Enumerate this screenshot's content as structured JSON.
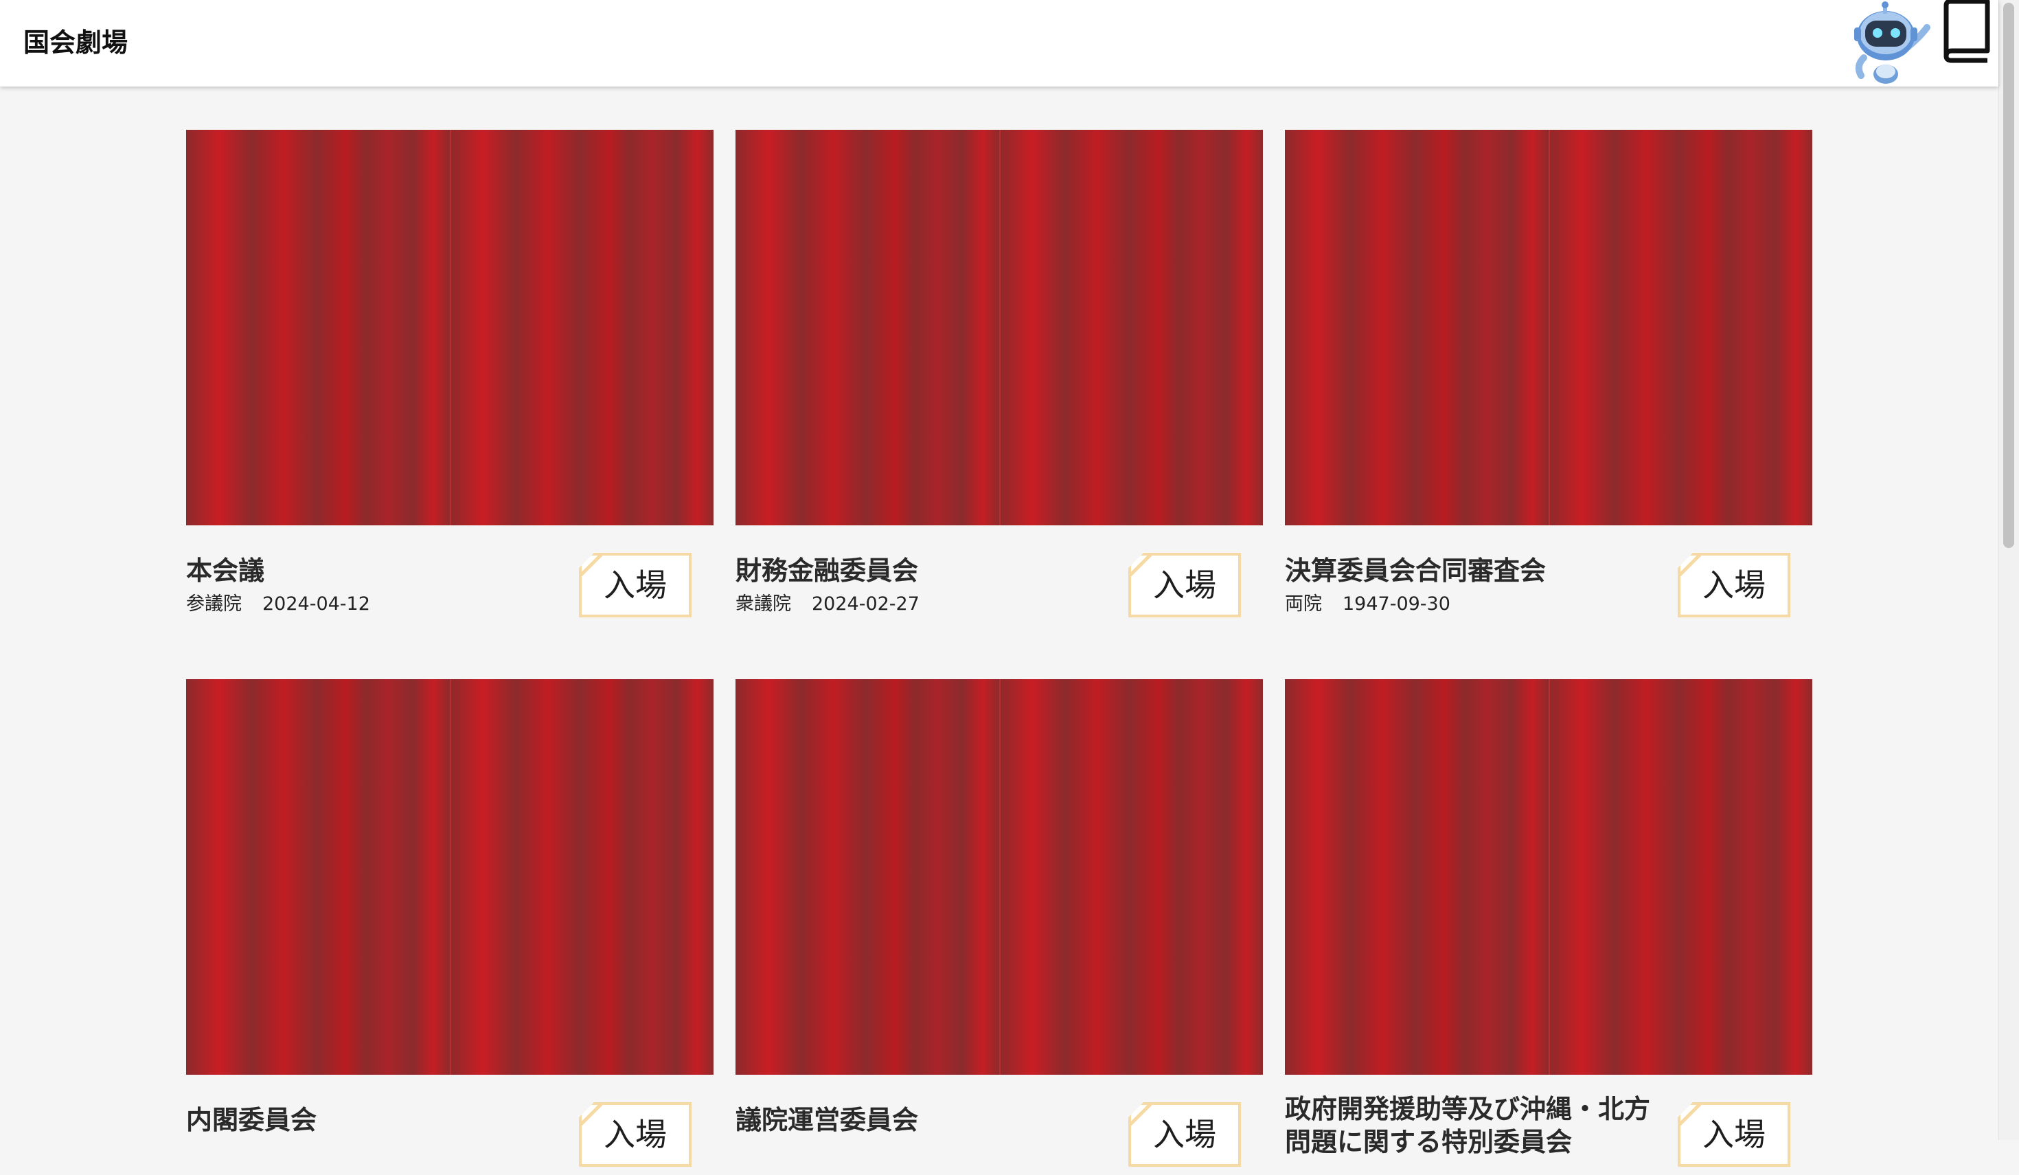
{
  "app": {
    "title": "国会劇場"
  },
  "header": {
    "robot_icon": "robot-mascot-icon",
    "book_icon": "book-icon"
  },
  "colors": {
    "curtain_red": "#c81e24",
    "curtain_dark": "#8c2a2c",
    "button_border": "#f6d9a3",
    "background": "#f5f5f5"
  },
  "sessions": [
    {
      "title": "本会議",
      "house": "参議院",
      "date": "2024-04-12",
      "enter_label": "入場"
    },
    {
      "title": "財務金融委員会",
      "house": "衆議院",
      "date": "2024-02-27",
      "enter_label": "入場"
    },
    {
      "title": "決算委員会合同審査会",
      "house": "両院",
      "date": "1947-09-30",
      "enter_label": "入場"
    },
    {
      "title": "内閣委員会",
      "house": "",
      "date": "",
      "enter_label": "入場"
    },
    {
      "title": "議院運営委員会",
      "house": "",
      "date": "",
      "enter_label": "入場"
    },
    {
      "title": "政府開発援助等及び沖縄・北方問題に関する特別委員会",
      "house": "",
      "date": "",
      "enter_label": "入場"
    }
  ]
}
